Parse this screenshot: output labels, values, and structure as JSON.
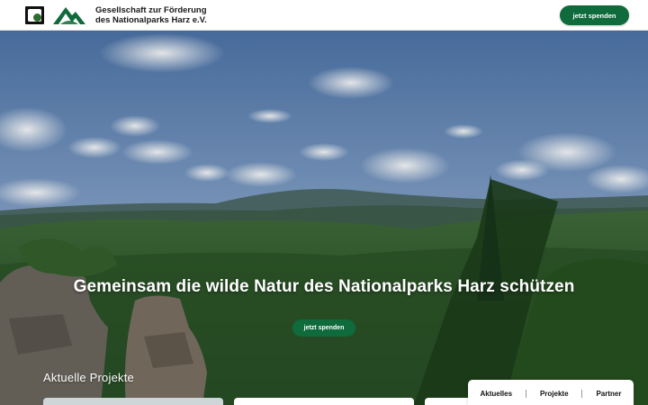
{
  "header": {
    "org_name_line1": "Gesellschaft zur Förderung",
    "org_name_line2": "des Nationalparks Harz e.V.",
    "donate_label": "jetzt spenden",
    "logo_icon": "national-park-emblem-icon",
    "mountain_icon": "mountain-logo-icon",
    "accent_color": "#0f6a3c"
  },
  "hero": {
    "title": "Gemeinsam die wilde Natur des Nationalparks Harz schützen",
    "donate_label": "jetzt spenden"
  },
  "projects": {
    "section_title": "Aktuelle Projekte"
  },
  "tabs": [
    {
      "label": "Aktuelles"
    },
    {
      "label": "Projekte"
    },
    {
      "label": "Partner"
    }
  ]
}
